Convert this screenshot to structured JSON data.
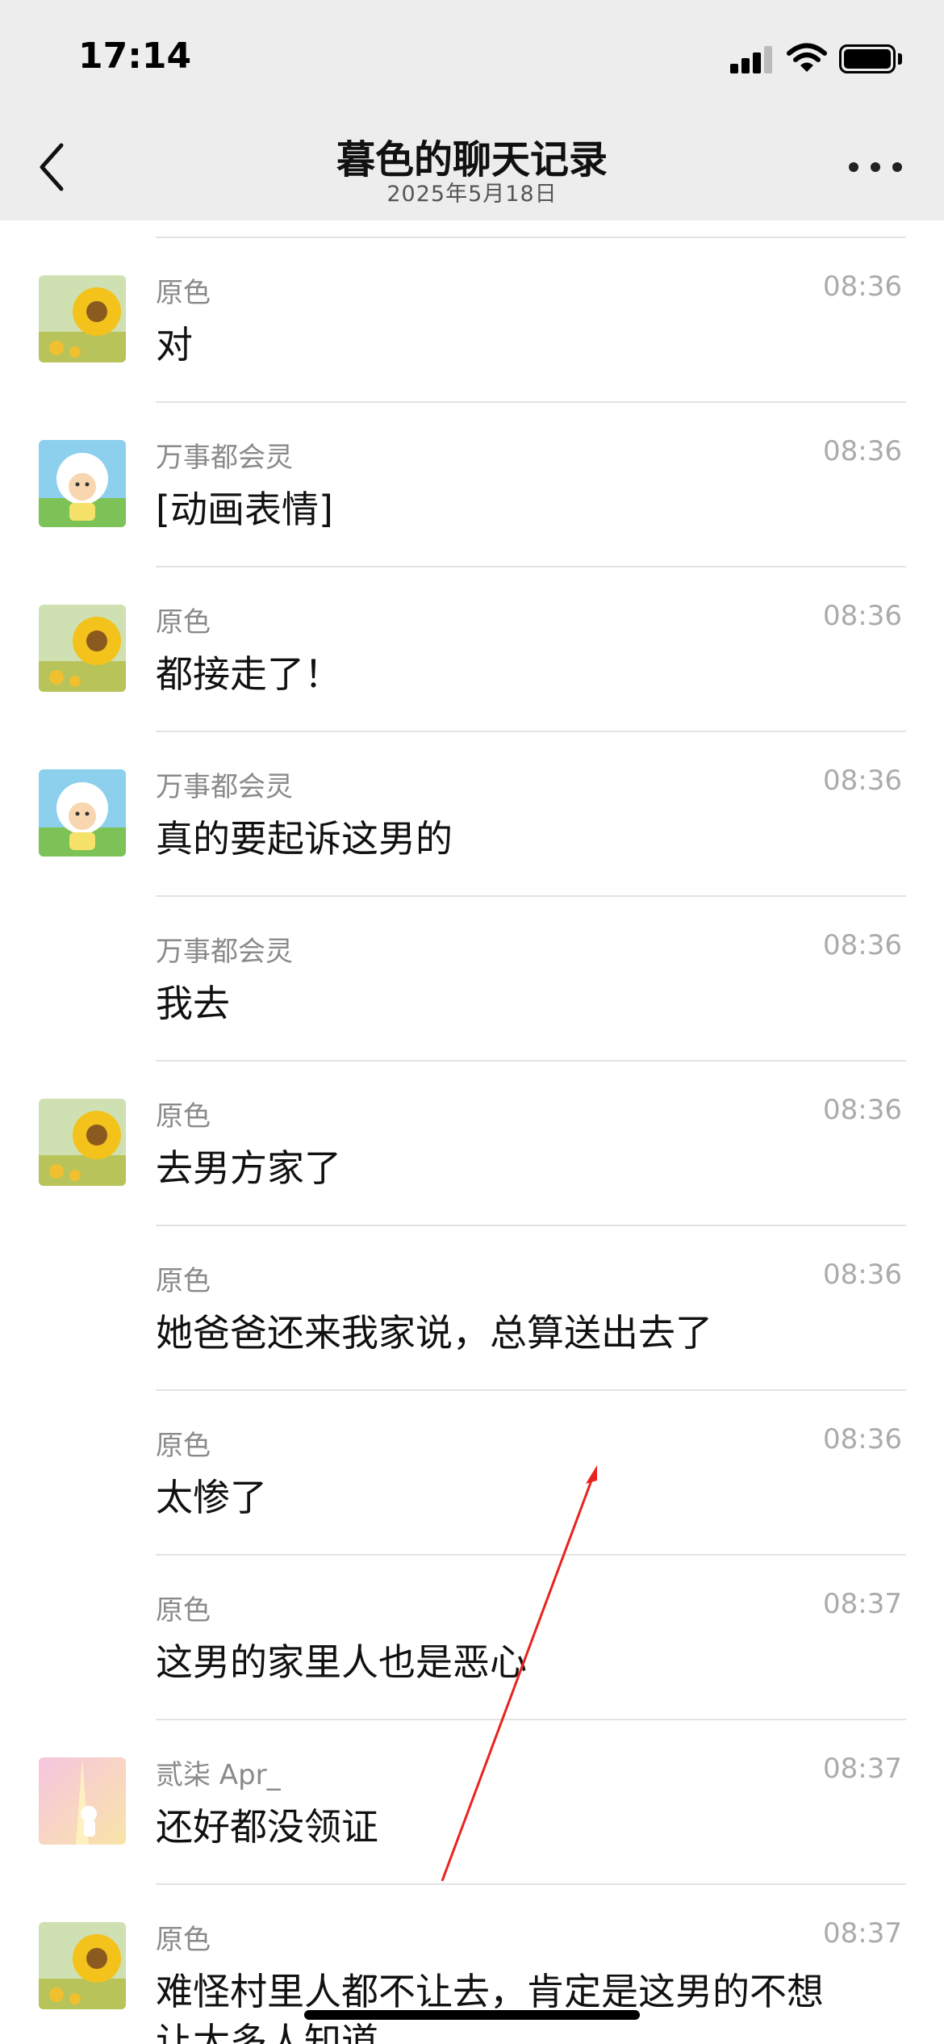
{
  "status_bar": {
    "time": "17:14"
  },
  "nav": {
    "title": "暮色的聊天记录",
    "subtitle": "2025年5月18日"
  },
  "colors": {
    "accent_annotation": "#e8231f",
    "sunflower": "#f3c21b",
    "sheep_bg": "#8dd0ee"
  },
  "messages": [
    {
      "sender": "原色",
      "time": "08:36",
      "text": "对",
      "avatar": "sunflower-avatar"
    },
    {
      "sender": "万事都会灵",
      "time": "08:36",
      "text": "[动画表情]",
      "avatar": "sheep-avatar"
    },
    {
      "sender": "原色",
      "time": "08:36",
      "text": "都接走了！",
      "avatar": "sunflower-avatar"
    },
    {
      "sender": "万事都会灵",
      "time": "08:36",
      "text": "真的要起诉这男的",
      "avatar": "sheep-avatar"
    },
    {
      "sender": "万事都会灵",
      "time": "08:36",
      "text": "我去",
      "avatar": ""
    },
    {
      "sender": "原色",
      "time": "08:36",
      "text": "去男方家了",
      "avatar": "sunflower-avatar"
    },
    {
      "sender": "原色",
      "time": "08:36",
      "text": "她爸爸还来我家说，总算送出去了",
      "avatar": ""
    },
    {
      "sender": "原色",
      "time": "08:36",
      "text": "太惨了",
      "avatar": ""
    },
    {
      "sender": "原色",
      "time": "08:37",
      "text": "这男的家里人也是恶心",
      "avatar": ""
    },
    {
      "sender": "贰柒 Apr_",
      "time": "08:37",
      "text": "还好都没领证",
      "avatar": "pink-avatar"
    },
    {
      "sender": "原色",
      "time": "08:37",
      "text": "难怪村里人都不让去，肯定是这男的不想",
      "text2": "让太多人知道",
      "avatar": "sunflower-avatar"
    }
  ]
}
